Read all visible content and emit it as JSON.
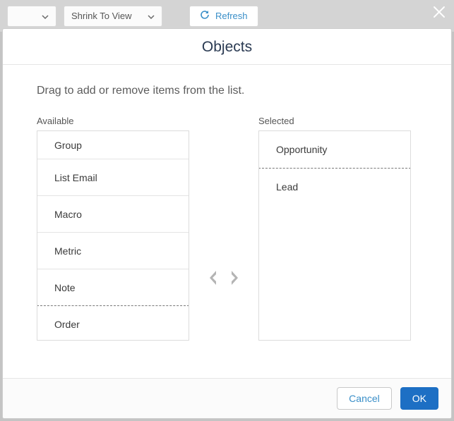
{
  "toolbar": {
    "shrink_label": "Shrink To View",
    "refresh_label": "Refresh"
  },
  "modal": {
    "title": "Objects",
    "instruction": "Drag to add or remove items from the list.",
    "available_label": "Available",
    "selected_label": "Selected",
    "available_items": [
      "Group",
      "List Email",
      "Macro",
      "Metric",
      "Note",
      "Order"
    ],
    "selected_items": [
      "Opportunity",
      "Lead"
    ],
    "cancel_label": "Cancel",
    "ok_label": "OK"
  }
}
